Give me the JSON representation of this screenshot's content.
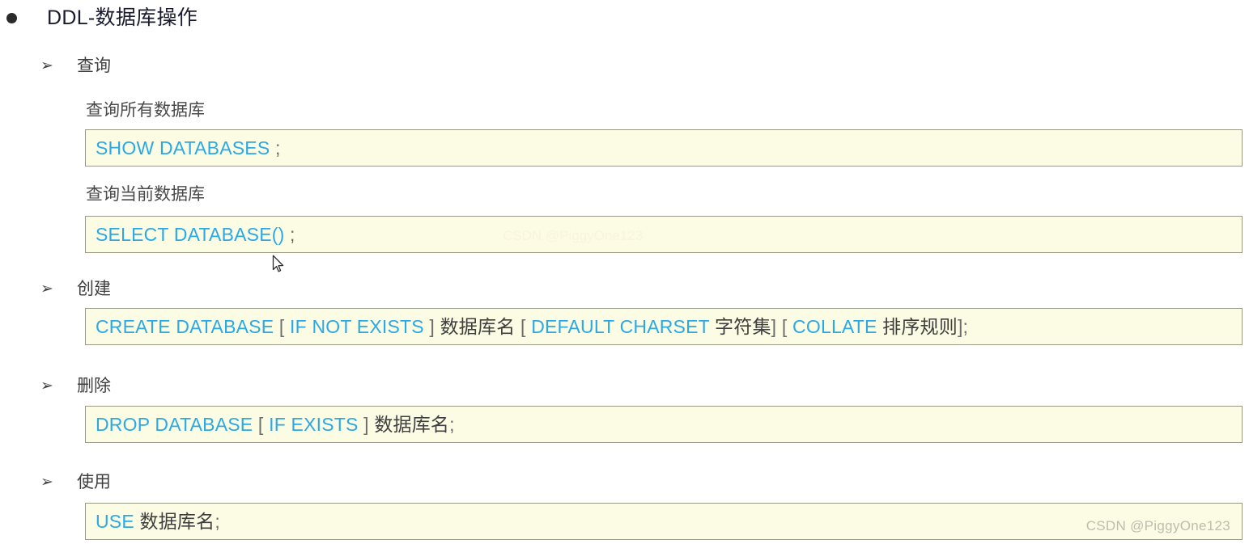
{
  "document": {
    "title": "DDL-数据库操作",
    "bullet_level1_glyph": "●",
    "bullet_level2_glyph": "➢"
  },
  "sections": [
    {
      "heading": "查询",
      "sub_labels": [
        "查询所有数据库",
        "查询当前数据库"
      ],
      "code_blocks": [
        {
          "id": "show-databases",
          "full_text": "SHOW DATABASES ;",
          "tokens": [
            {
              "text": "SHOW DATABASES",
              "type": "keyword"
            },
            {
              "text": " ;",
              "type": "punctuation"
            }
          ]
        },
        {
          "id": "select-database",
          "full_text": "SELECT DATABASE() ;",
          "tokens": [
            {
              "text": "SELECT DATABASE()",
              "type": "keyword"
            },
            {
              "text": " ;",
              "type": "punctuation"
            }
          ]
        }
      ]
    },
    {
      "heading": "创建",
      "sub_labels": [],
      "code_blocks": [
        {
          "id": "create-database",
          "full_text": "CREATE DATABASE [ IF NOT EXISTS ] 数据库名 [ DEFAULT CHARSET 字符集] [ COLLATE  排序规则];",
          "tokens": [
            {
              "text": "CREATE DATABASE",
              "type": "keyword"
            },
            {
              "text": " [ ",
              "type": "punctuation"
            },
            {
              "text": "IF NOT EXISTS",
              "type": "keyword"
            },
            {
              "text": " ] ",
              "type": "punctuation"
            },
            {
              "text": "数据库名",
              "type": "chinese"
            },
            {
              "text": " [ ",
              "type": "punctuation"
            },
            {
              "text": "DEFAULT CHARSET",
              "type": "keyword"
            },
            {
              "text": " 字符集",
              "type": "chinese"
            },
            {
              "text": "] [ ",
              "type": "punctuation"
            },
            {
              "text": "COLLATE",
              "type": "keyword"
            },
            {
              "text": "  排序规则",
              "type": "chinese"
            },
            {
              "text": "];",
              "type": "punctuation"
            }
          ]
        }
      ]
    },
    {
      "heading": "删除",
      "sub_labels": [],
      "code_blocks": [
        {
          "id": "drop-database",
          "full_text": "DROP DATABASE [ IF EXISTS ] 数据库名;",
          "tokens": [
            {
              "text": "DROP DATABASE",
              "type": "keyword"
            },
            {
              "text": " [ ",
              "type": "punctuation"
            },
            {
              "text": "IF EXISTS",
              "type": "keyword"
            },
            {
              "text": " ] ",
              "type": "punctuation"
            },
            {
              "text": "数据库名",
              "type": "chinese"
            },
            {
              "text": ";",
              "type": "punctuation"
            }
          ]
        }
      ]
    },
    {
      "heading": "使用",
      "sub_labels": [],
      "code_blocks": [
        {
          "id": "use-database",
          "full_text": "USE 数据库名;",
          "tokens": [
            {
              "text": "USE",
              "type": "keyword"
            },
            {
              "text": "  ",
              "type": "punctuation"
            },
            {
              "text": "数据库名",
              "type": "chinese"
            },
            {
              "text": ";",
              "type": "punctuation"
            }
          ]
        }
      ]
    }
  ],
  "watermark": {
    "text": "CSDN @PiggyOne123",
    "faint_text": "CSDN @PiggyOne123"
  },
  "colors": {
    "keyword": "#2aa9e6",
    "punctuation": "#6d6d6d",
    "chinese": "#3f3f3f",
    "code_background": "#fcfbe3",
    "code_border": "#9a9a86",
    "title": "#1b1b2f",
    "heading": "#3f3f3f",
    "watermark": "#bdbdb0"
  }
}
